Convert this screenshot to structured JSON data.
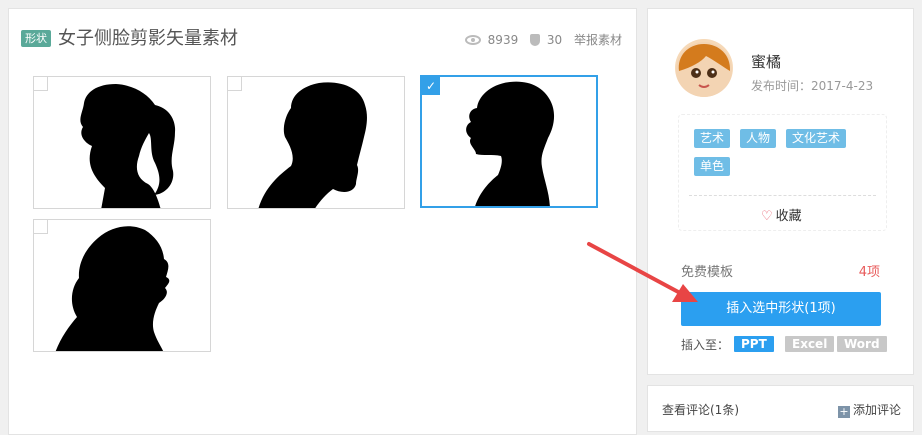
{
  "material": {
    "tag": "形状",
    "title": "女子侧脸剪影矢量素材",
    "views": "8939",
    "likes": "30",
    "report": "举报素材"
  },
  "thumbnails": [
    {
      "selected": false,
      "icon": "ponytail-woman-silhouette-icon"
    },
    {
      "selected": false,
      "icon": "curly-hair-woman-silhouette-icon"
    },
    {
      "selected": true,
      "icon": "profile-woman-silhouette-icon"
    },
    {
      "selected": false,
      "icon": "long-curly-hair-woman-silhouette-icon"
    }
  ],
  "author": {
    "name": "蜜橘",
    "publish_time": "发布时间：2017-4-23"
  },
  "tags": [
    "艺术",
    "人物",
    "文化艺术",
    "单色"
  ],
  "favorite_label": "收藏",
  "free_template_label": "免费模板",
  "item_count": "4项",
  "insert_button_label": "插入选中形状(1项)",
  "insert_to_label": "插入至：",
  "apps": [
    "PPT",
    "Excel",
    "Word"
  ],
  "comments": {
    "view_label": "查看评论(1条)",
    "add_label": "添加评论"
  },
  "colors": {
    "accent": "#2b9ff0",
    "tag": "#6fbde6",
    "warning": "#e85b5b"
  }
}
